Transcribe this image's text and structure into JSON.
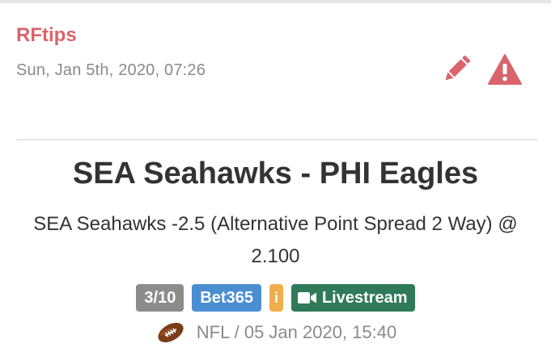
{
  "post": {
    "author": "RFtips",
    "timestamp": "Sun, Jan 5th, 2020, 07:26"
  },
  "tip": {
    "match_title": "SEA Seahawks - PHI Eagles",
    "bet_description": "SEA Seahawks -2.5 (Alternative Point Spread 2 Way) @ 2.100",
    "rating": "3/10",
    "bookmaker": "Bet365",
    "info_label": "i",
    "livestream_label": "Livestream",
    "league_date": "NFL / 05 Jan 2020, 15:40"
  },
  "colors": {
    "author": "#d9646c",
    "action_icons": "#d9646c",
    "rating_badge": "#8c8c8c",
    "bookmaker_badge": "#4a8ed2",
    "info_badge": "#efae4c",
    "livestream_badge": "#2f7a59"
  },
  "icons": {
    "edit": "pencil-icon",
    "report": "warning-icon",
    "livestream": "video-camera-icon",
    "sport": "american-football-icon"
  }
}
